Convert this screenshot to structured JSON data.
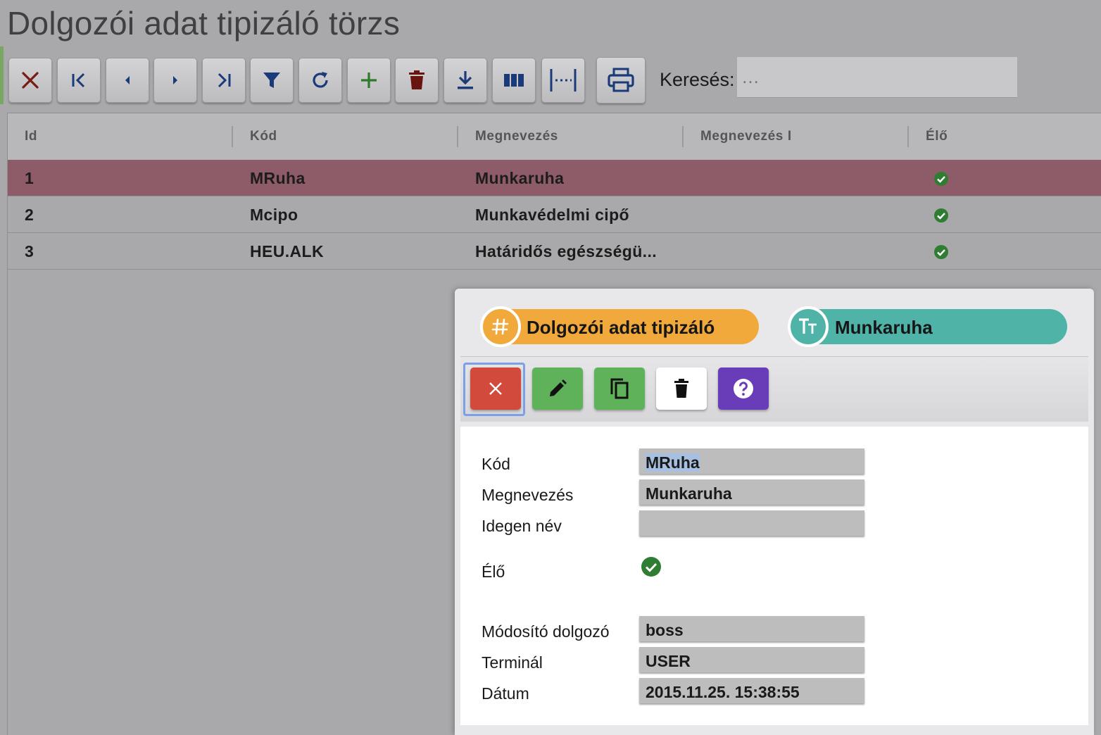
{
  "page": {
    "title": "Dolgozói adat tipizáló törzs"
  },
  "search": {
    "label": "Keresés:",
    "placeholder": "…",
    "value": ""
  },
  "grid": {
    "columns": [
      "Id",
      "Kód",
      "Megnevezés",
      "Megnevezés I",
      "Élő"
    ],
    "rows": [
      {
        "id": "1",
        "kod": "MRuha",
        "megnevezes": "Munkaruha",
        "megnevezes_i": "",
        "elo": true,
        "selected": true
      },
      {
        "id": "2",
        "kod": "Mcipo",
        "megnevezes": "Munkavédelmi cipő",
        "megnevezes_i": "",
        "elo": true,
        "selected": false
      },
      {
        "id": "3",
        "kod": "HEU.ALK",
        "megnevezes": "Határidős egészségü...",
        "megnevezes_i": "",
        "elo": true,
        "selected": false
      }
    ]
  },
  "toolbar_icons": [
    "close-icon",
    "first-record-icon",
    "previous-record-icon",
    "next-record-icon",
    "last-record-icon",
    "filter-icon",
    "refresh-icon",
    "add-icon",
    "delete-icon",
    "download-icon",
    "columns-icon",
    "fit-width-icon",
    "print-icon"
  ],
  "dialog": {
    "pill_type": "Dolgozói adat tipizáló",
    "pill_name": "Munkaruha",
    "buttons": [
      "close-icon",
      "edit-icon",
      "copy-icon",
      "delete-icon",
      "help-icon"
    ],
    "fields": {
      "kod_label": "Kód",
      "kod_value": "MRuha",
      "megnevezes_label": "Megnevezés",
      "megnevezes_value": "Munkaruha",
      "idegen_label": "Idegen név",
      "idegen_value": "",
      "elo_label": "Élő",
      "elo_value": true,
      "modosito_label": "Módosító dolgozó",
      "modosito_value": "boss",
      "terminal_label": "Terminál",
      "terminal_value": "USER",
      "datum_label": "Dátum",
      "datum_value": "2015.11.25. 15:38:55"
    }
  },
  "colors": {
    "selected_row": "#8e5c68",
    "check_green": "#2e7d32",
    "pill_orange": "#f2a93b",
    "pill_teal": "#4fb3a8",
    "btn_red": "#d24a3c",
    "btn_green": "#5fb15a",
    "btn_purple": "#6a3db8"
  }
}
